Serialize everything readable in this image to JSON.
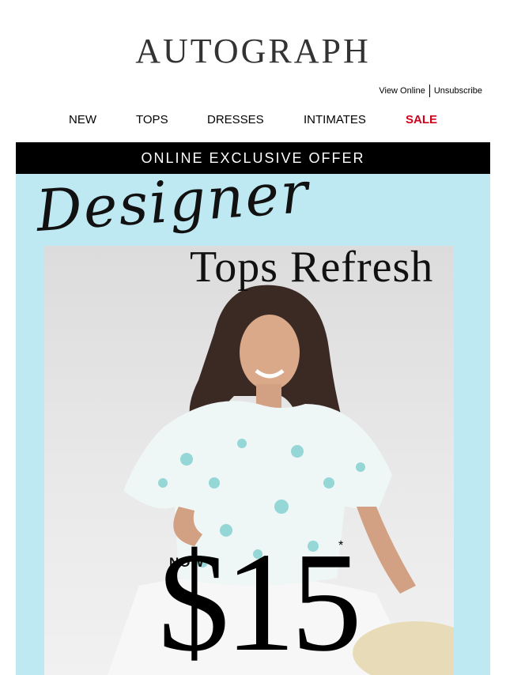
{
  "header": {
    "logo": "AUTOGRAPH",
    "view_online": "View Online",
    "unsubscribe": "Unsubscribe"
  },
  "nav": {
    "items": [
      "NEW",
      "TOPS",
      "DRESSES",
      "INTIMATES",
      "SALE"
    ]
  },
  "banner": {
    "offer": "ONLINE EXCLUSIVE OFFER"
  },
  "hero": {
    "script_title": "Designer",
    "title": "Tops Refresh",
    "price_prefix": "NOW",
    "price": "$15",
    "price_note": "*",
    "background_color": "#bfe9f2"
  },
  "colors": {
    "sale": "#d0021b",
    "bar": "#000000"
  }
}
